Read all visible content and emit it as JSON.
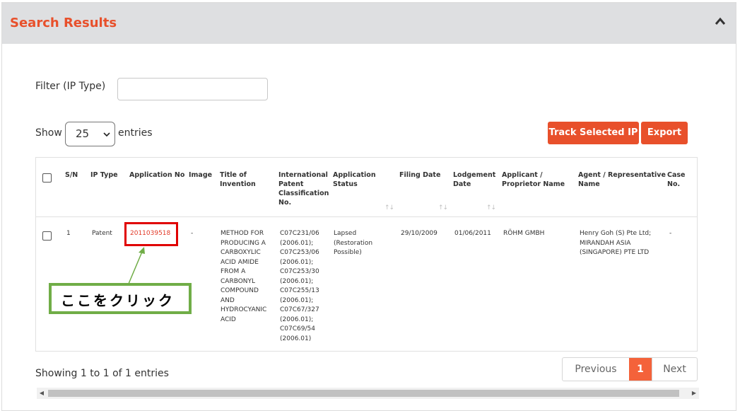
{
  "header": {
    "title": "Search Results",
    "collapse_icon": "chevron-up-icon"
  },
  "filter": {
    "label": "Filter (IP Type)",
    "value": "",
    "placeholder": ""
  },
  "length": {
    "show": "Show",
    "selected": "25",
    "entries": "entries"
  },
  "buttons": {
    "track": "Track Selected IP",
    "export": "Export"
  },
  "table": {
    "headers": {
      "sn": "S/N",
      "ip_type": "IP Type",
      "app_no": "Application No",
      "image": "Image",
      "title": [
        "Title of",
        "Invention"
      ],
      "ipc": [
        "International",
        "Patent",
        "Classification",
        "No."
      ],
      "status": [
        "Application",
        "Status"
      ],
      "filing": "Filing Date",
      "lodgement": [
        "Lodgement",
        "Date"
      ],
      "applicant": [
        "Applicant /",
        "Proprietor Name"
      ],
      "agent": [
        "Agent / Representative",
        "Name"
      ],
      "case": [
        "Case",
        "No."
      ]
    },
    "row": {
      "sn": "1",
      "ip_type": "Patent",
      "app_no": "2011039518",
      "image": "-",
      "title": [
        "METHOD FOR",
        "PRODUCING A",
        "CARBOXYLIC",
        "ACID AMIDE",
        "FROM A",
        "CARBONYL",
        "COMPOUND",
        "AND",
        "HYDROCYANIC",
        "ACID"
      ],
      "ipc": [
        "C07C231/06",
        "(2006.01);",
        "C07C253/06",
        "(2006.01);",
        "C07C253/30",
        "(2006.01);",
        "C07C255/13",
        "(2006.01);",
        "C07C67/327",
        "(2006.01);",
        "C07C69/54",
        "(2006.01)"
      ],
      "status": [
        "Lapsed",
        "(Restoration",
        "Possible)"
      ],
      "filing": "29/10/2009",
      "lodgement": "01/06/2011",
      "applicant": "RÖHM GMBH",
      "agent": [
        "Henry Goh (S) Pte Ltd;",
        "MIRANDAH ASIA",
        "(SINGAPORE) PTE LTD"
      ],
      "case": "-"
    }
  },
  "annotation": {
    "callout": "ここをクリック"
  },
  "footer": {
    "info": "Showing 1 to 1 of 1 entries",
    "prev": "Previous",
    "page": "1",
    "next": "Next"
  },
  "colors": {
    "accent": "#e8502b",
    "link": "#e23a28",
    "highlight": "#e00000",
    "callout_border": "#70ad47"
  }
}
